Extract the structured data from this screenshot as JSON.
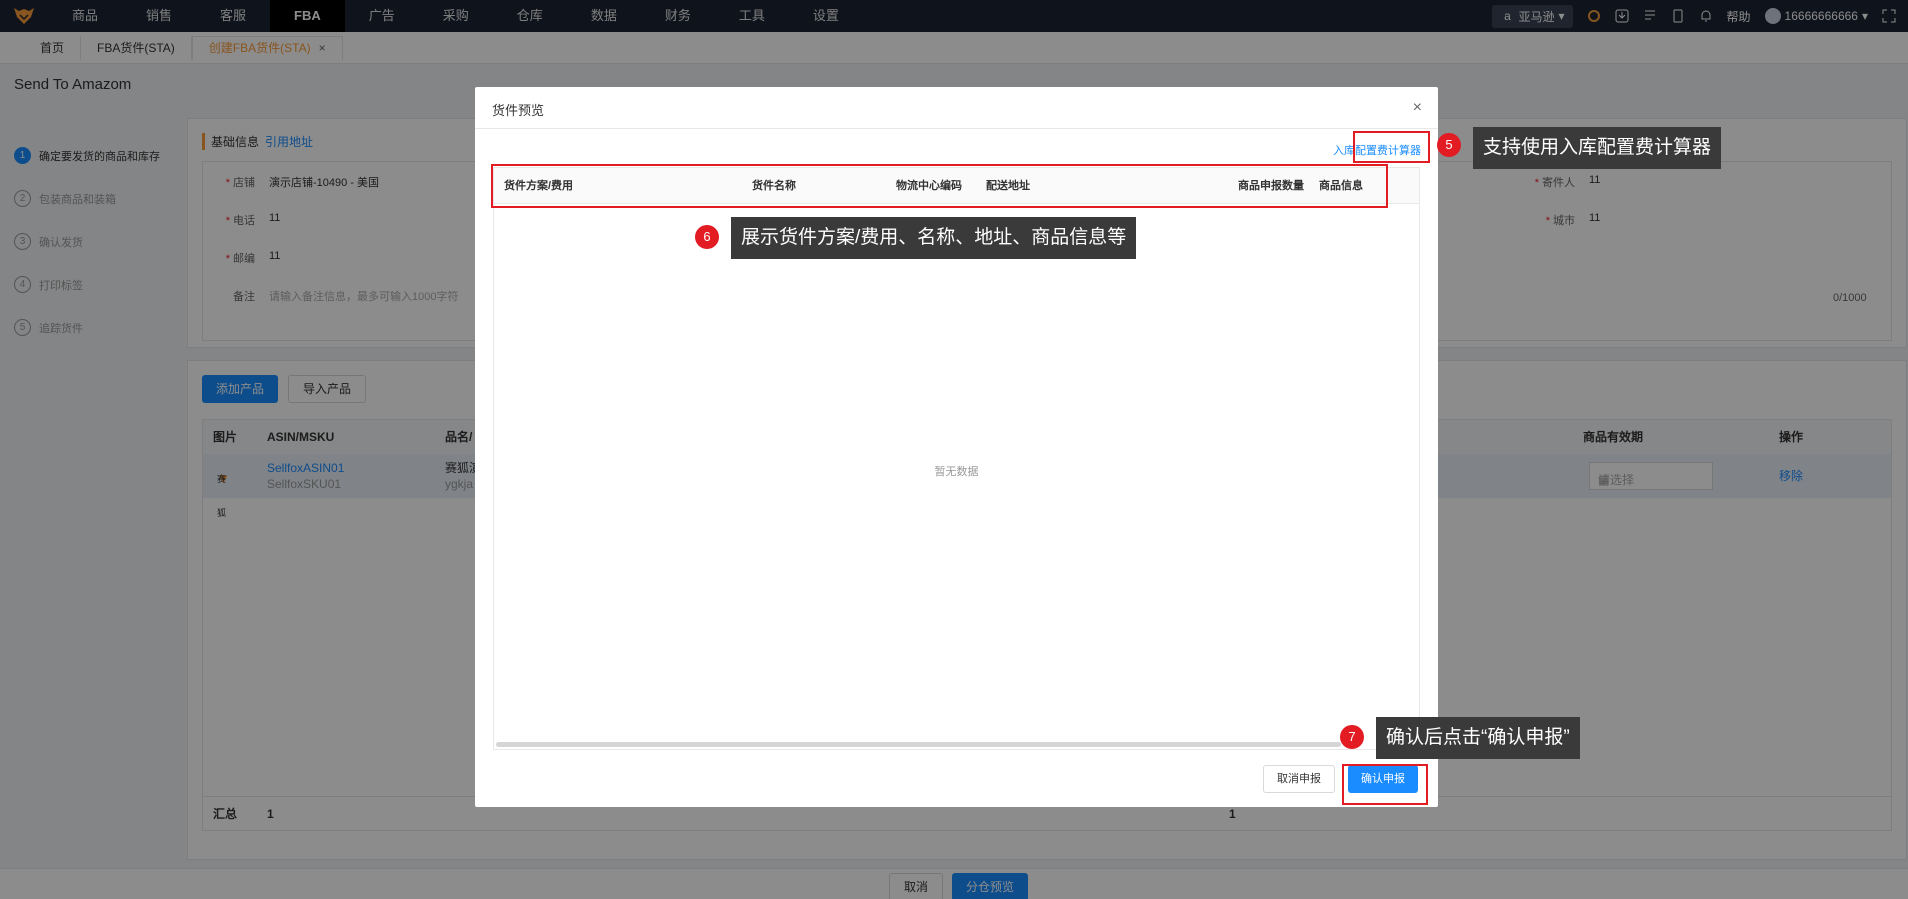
{
  "nav": {
    "items": [
      "商品",
      "销售",
      "客服",
      "FBA",
      "广告",
      "采购",
      "仓库",
      "数据",
      "财务",
      "工具",
      "设置"
    ],
    "active_index": 3,
    "marketplace": "亚马逊",
    "help": "帮助",
    "user": "16666666666"
  },
  "tabs": {
    "home": "首页",
    "sta": "FBA货件(STA)",
    "create": "创建FBA货件(STA)",
    "close": "×"
  },
  "page": {
    "title": "Send To Amazom",
    "steps": [
      {
        "num": "1",
        "label": "确定要发货的商品和库存"
      },
      {
        "num": "2",
        "label": "包装商品和装箱"
      },
      {
        "num": "3",
        "label": "确认发货"
      },
      {
        "num": "4",
        "label": "打印标签"
      },
      {
        "num": "5",
        "label": "追踪货件"
      }
    ]
  },
  "basic": {
    "title": "基础信息",
    "cite_link": "引用地址",
    "store_label": "店铺",
    "store_value": "演示店铺-10490 - 美国",
    "phone_label": "电话",
    "phone_value": "11",
    "zip_label": "邮编",
    "zip_value": "11",
    "remark_label": "备注",
    "remark_placeholder": "请输入备注信息，最多可输入1000字符",
    "sender_label": "寄件人",
    "sender_value": "11",
    "city_label": "城市",
    "city_value": "11",
    "counter": "0/1000"
  },
  "products": {
    "add_button": "添加产品",
    "import_button": "导入产品",
    "columns": {
      "image": "图片",
      "asin": "ASIN/MSKU",
      "name": "品名/",
      "expiry": "商品有效期",
      "action": "操作"
    },
    "row": {
      "logo_text": "赛狐",
      "asin": "SellfoxASIN01",
      "sku": "SellfoxSKU01",
      "name": "赛狐演",
      "name_sub": "ygkja",
      "date_placeholder": "请选择",
      "remove": "移除"
    },
    "footer": {
      "label": "汇总",
      "count1": "1",
      "count2": "1"
    }
  },
  "bottom": {
    "cancel": "取消",
    "preview": "分仓预览"
  },
  "modal": {
    "title": "货件预览",
    "close": "×",
    "calc_link": "入库配置费计算器",
    "columns": [
      "货件方案/费用",
      "货件名称",
      "物流中心编码",
      "配送地址",
      "商品申报数量",
      "商品信息"
    ],
    "empty_text": "暂无数据",
    "cancel_button": "取消申报",
    "confirm_button": "确认申报"
  },
  "callouts": {
    "c5": {
      "num": "5",
      "text": "支持使用入库配置费计算器"
    },
    "c6": {
      "num": "6",
      "text": "展示货件方案/费用、名称、地址、商品信息等"
    },
    "c7": {
      "num": "7",
      "text": "确认后点击“确认申报”"
    }
  },
  "colors": {
    "accent": "#1a8cff",
    "brand": "#f89b3a",
    "nav_bg": "#1c2434",
    "callout_red": "#e31b23"
  }
}
